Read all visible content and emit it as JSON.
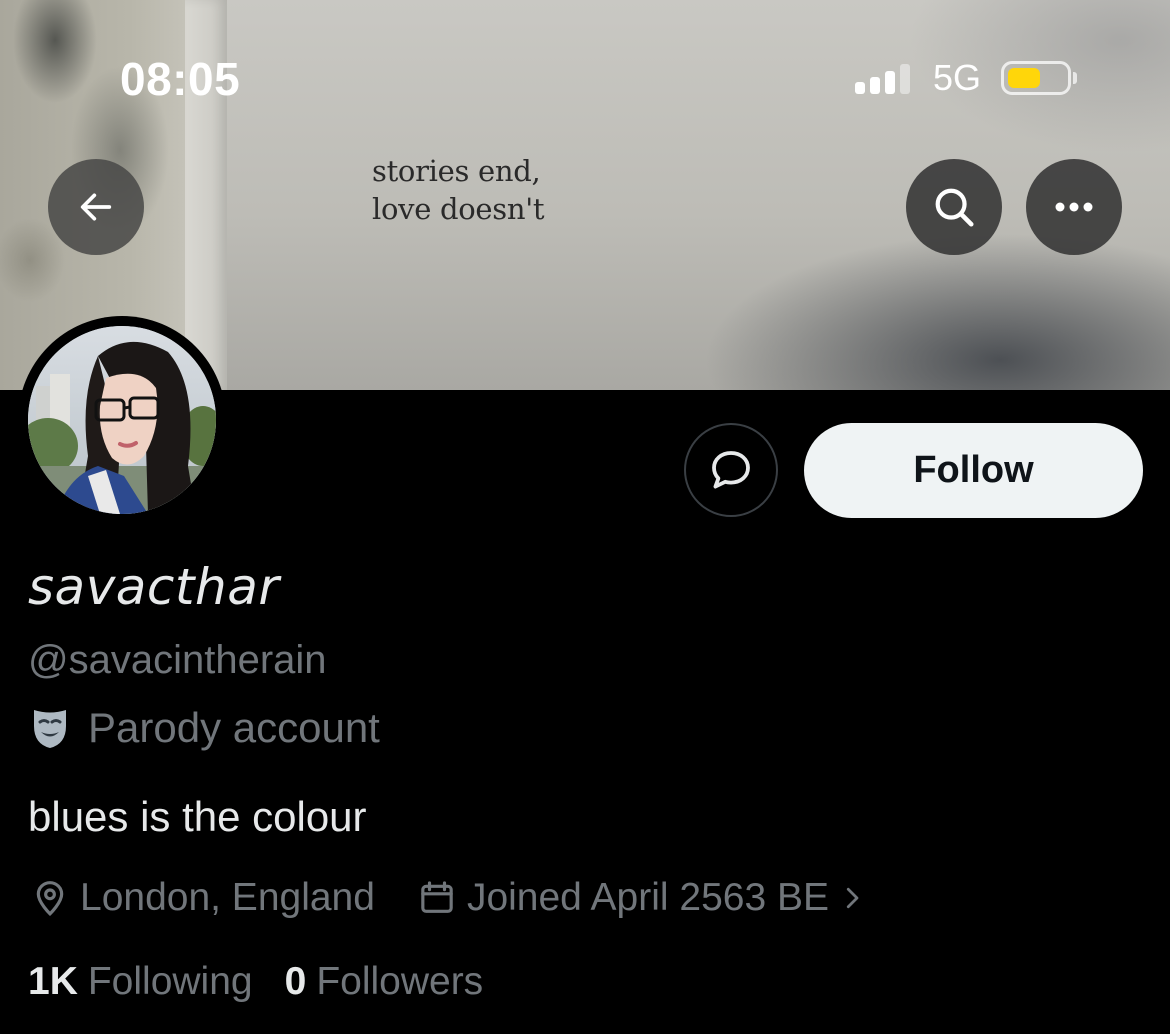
{
  "status_bar": {
    "time": "08:05",
    "network": "5G",
    "signal_bars_active": 3,
    "signal_bars_total": 4,
    "battery_level": 0.55,
    "battery_color": "#ffd60a"
  },
  "header": {
    "back_icon": "arrow-left-icon",
    "search_icon": "search-icon",
    "more_icon": "more-horizontal-icon"
  },
  "banner": {
    "book_text_line1": "stories end,",
    "book_text_line2": "love doesn't"
  },
  "actions": {
    "message_icon": "chat-bubble-icon",
    "follow_label": "Follow"
  },
  "profile": {
    "display_name": "savacthar",
    "handle": "@savacintherain",
    "parody_label": "Parody account",
    "parody_icon": "theater-mask-icon",
    "bio": "blues is the colour",
    "location": "London, England",
    "location_icon": "location-pin-icon",
    "joined": "Joined April 2563 BE",
    "joined_icon": "calendar-icon",
    "joined_chevron_icon": "chevron-right-icon"
  },
  "stats": {
    "following_count": "1K",
    "following_label": "Following",
    "followers_count": "0",
    "followers_label": "Followers"
  },
  "colors": {
    "background": "#000000",
    "primary_text": "#e7e9ea",
    "secondary_text": "#71767b",
    "follow_button_bg": "#eff3f4"
  }
}
